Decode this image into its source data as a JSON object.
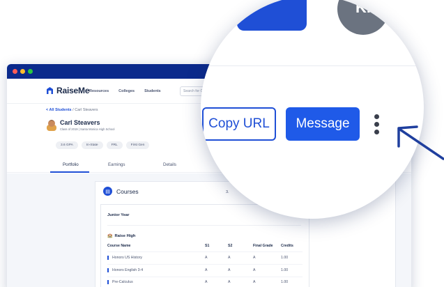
{
  "app": {
    "brand": "RaiseMe",
    "accent": "#1f4fd6",
    "titlebar_color": "#0b2a8c"
  },
  "nav": {
    "links": [
      "Resources",
      "Colleges",
      "Students"
    ],
    "search_placeholder": "Search for Colleges"
  },
  "breadcrumb": {
    "back": "< All Students",
    "separator": " / ",
    "current": "Carl Steavers"
  },
  "student": {
    "name": "Carl Steavers",
    "subtitle": "Class of 2019 | Santa Monica High School",
    "tags": [
      "3.6 GPA",
      "In-State",
      "FRL",
      "First Gen"
    ]
  },
  "tabs": {
    "items": [
      "Portfolio",
      "Earnings",
      "Details"
    ],
    "active": "Portfolio"
  },
  "courses": {
    "title": "Courses",
    "gpa_peek": "3.",
    "year": "Junior Year",
    "school": "Raise High",
    "columns": [
      "Course Name",
      "S1",
      "S2",
      "Final Grade",
      "Credits"
    ],
    "rows": [
      {
        "name": "Honors US History",
        "s1": "A",
        "s2": "A",
        "final": "A",
        "credits": "1.00"
      },
      {
        "name": "Honors English 3-4",
        "s1": "A",
        "s2": "A",
        "final": "A",
        "credits": "1.00"
      },
      {
        "name": "Pre-Calculus",
        "s1": "A",
        "s2": "A",
        "final": "A",
        "credits": "1.00"
      }
    ]
  },
  "magnifier": {
    "copy_url_label": "Copy URL",
    "message_label": "Message",
    "avatar_initials": "KI",
    "more_icon": "kebab-menu-icon",
    "arrow_icon": "pointer-arrow-icon"
  }
}
